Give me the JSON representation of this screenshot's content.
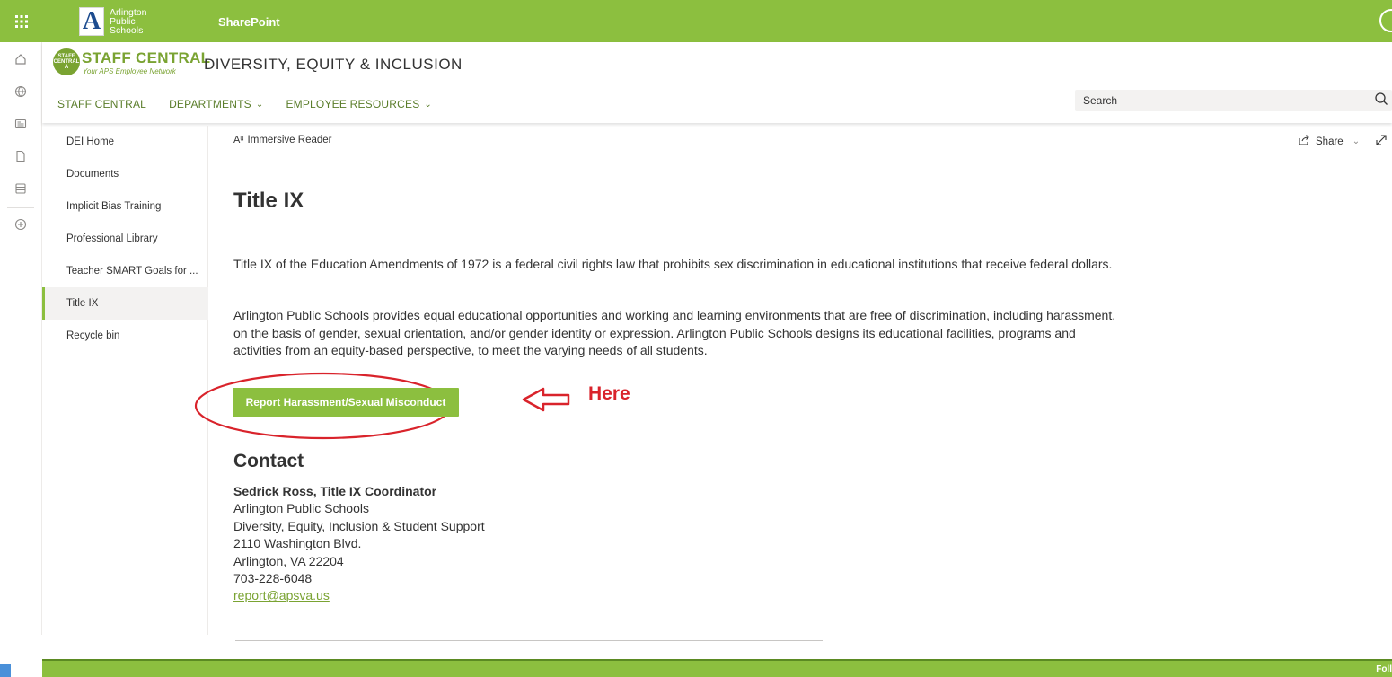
{
  "suitebar": {
    "org_line1": "Arlington",
    "org_line2": "Public",
    "org_line3": "Schools",
    "logo_letter": "A",
    "app_name": "SharePoint"
  },
  "site": {
    "badge_line1": "STAFF",
    "badge_line2": "CENTRAL",
    "badge_line3": "A",
    "brand": "STAFF CENTRAL",
    "tagline": "Your APS Employee Network",
    "title": "DIVERSITY, EQUITY & INCLUSION"
  },
  "nav": {
    "items": [
      {
        "label": "STAFF CENTRAL"
      },
      {
        "label": "DEPARTMENTS"
      },
      {
        "label": "EMPLOYEE RESOURCES"
      }
    ],
    "search_placeholder": "Search"
  },
  "leftnav": {
    "items": [
      {
        "label": "DEI Home"
      },
      {
        "label": "Documents"
      },
      {
        "label": "Implicit Bias Training"
      },
      {
        "label": "Professional Library"
      },
      {
        "label": "Teacher SMART Goals for ..."
      },
      {
        "label": "Title IX"
      },
      {
        "label": "Recycle bin"
      }
    ],
    "active": "Title IX"
  },
  "commandbar": {
    "immersive_reader": "Immersive Reader",
    "share": "Share"
  },
  "content": {
    "title": "Title IX",
    "para1": "Title IX of the Education Amendments of 1972 is a federal civil rights law that prohibits sex discrimination in educational institutions that receive federal dollars.",
    "para2": "Arlington Public Schools provides equal educational opportunities and working and learning environments that are free of discrimination, including harassment, on the basis of gender, sexual orientation, and/or gender identity or expression. Arlington Public Schools designs its educational facilities, programs and activities from an equity-based perspective, to meet the varying needs of all students.",
    "report_button": "Report Harassment/Sexual Misconduct",
    "annotation": "Here"
  },
  "contact": {
    "heading": "Contact",
    "name": "Sedrick Ross, Title IX Coordinator",
    "org": "Arlington Public Schools",
    "dept": "Diversity, Equity, Inclusion & Student Support",
    "street": "2110 Washington Blvd.",
    "city": "Arlington, VA 22204",
    "phone": "703-228-6048",
    "email": "report@apsva.us"
  },
  "footer": {
    "follow": "Foll"
  },
  "colors": {
    "brand_green": "#8cbf3f",
    "annotation_red": "#d9232b"
  }
}
